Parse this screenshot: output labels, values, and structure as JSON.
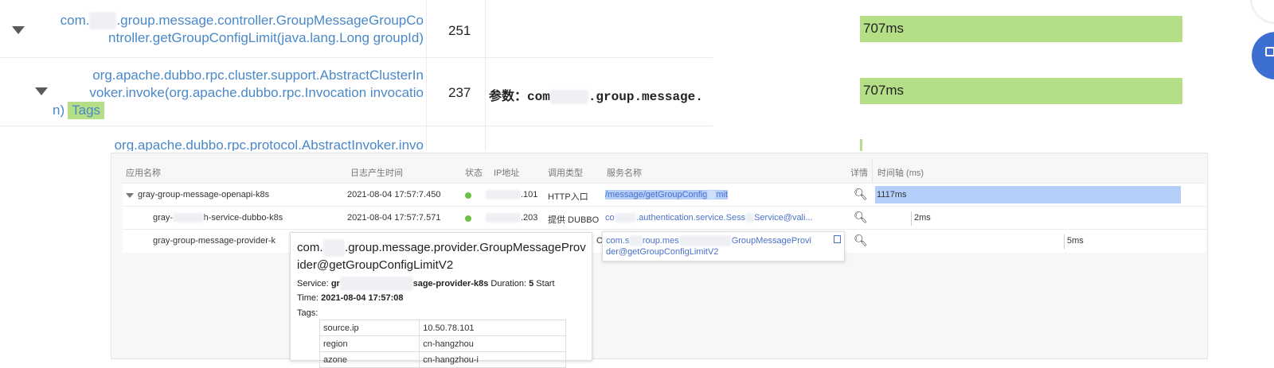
{
  "top_trace": {
    "rows": [
      {
        "method_line1_pre": "com.",
        "method_line1_mask": "xxxx",
        "method_line1_post": ".group.message.controller.GroupMessageGroupCo",
        "method_line2": "ntroller.getGroupConfigLimit(java.lang.Long groupId)",
        "count": "251",
        "params": "",
        "duration": "707ms"
      },
      {
        "method_line1": "org.apache.dubbo.rpc.cluster.support.AbstractClusterIn",
        "method_line2": "voker.invoke(org.apache.dubbo.rpc.Invocation invocatio",
        "method_line3": "n)",
        "tag": "Tags",
        "count": "237",
        "params_prefix": "参数：com",
        "params_mask": "xxxxx",
        "params_suffix": ".group.message.",
        "duration": "707ms"
      },
      {
        "method_line1": "org.apache.dubbo.rpc.protocol.AbstractInvoker.invo"
      }
    ]
  },
  "tracing": {
    "headers": {
      "app": "应用名称",
      "time": "日志产生时间",
      "status": "状态",
      "ip": "IP地址",
      "type": "调用类型",
      "service": "服务名称",
      "detail": "详情",
      "timeline": "时间轴 (ms)"
    },
    "rows": [
      {
        "app": "gray-group-message-openapi-k8s",
        "time": "2021-08-04 17:57:7.450",
        "ip": ".101",
        "type": "HTTP入口",
        "service": "/message/getGroupConfig",
        "service_tail": "mit",
        "duration": "1117ms"
      },
      {
        "app_pre": "gray-",
        "app_post": "h-service-dubbo-k8s",
        "time": "2021-08-04 17:57:7.571",
        "ip": ".203",
        "type": "提供 DUBBO",
        "service_pre": "co",
        "service_post": ".authentication.service.Sess",
        "service_post2": "Service@vali...",
        "duration": "2ms"
      },
      {
        "app": "gray-group-message-provider-k",
        "type_tail": "O",
        "service_line1_pre": "com.s",
        "service_line1_mid": "roup.mes",
        "service_line1_post": "GroupMessageProvi",
        "service_line2": "der@getGroupConfigLimitV2",
        "duration": "5ms"
      }
    ]
  },
  "popup": {
    "title_pre": "com.",
    "title_mid": "soul",
    "title_line1": ".group.message.provider.GroupMessageProv",
    "title_line2": "ider@getGroupConfigLimitV2",
    "service_label": "Service:",
    "service_pre": "gr",
    "service_post": "sage-provider-k8s",
    "duration_label": "Duration:",
    "duration_value": "5",
    "start_label": "Start",
    "time_label": "Time:",
    "time_value": "2021-08-04 17:57:08",
    "tags_label": "Tags:",
    "tags": [
      {
        "key": "source.ip",
        "value": "10.50.78.101"
      },
      {
        "key": "region",
        "value": "cn-hangzhou"
      },
      {
        "key": "azone",
        "value": "cn-hangzhou-i"
      }
    ]
  },
  "colors": {
    "green_bar": "#b5df86",
    "blue_bar": "#b3cffa",
    "link": "#4a88c8",
    "status_ok": "#6dbf4b"
  }
}
